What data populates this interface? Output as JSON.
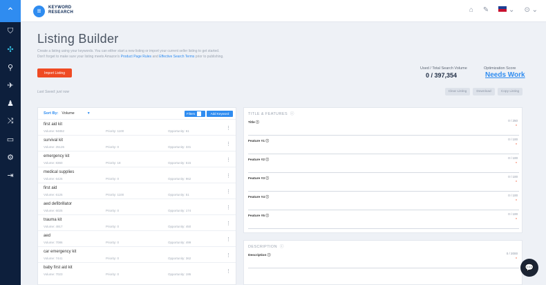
{
  "rail": {
    "items": [
      {
        "icon": "logo-icon",
        "glyph": "⌃"
      },
      {
        "icon": "shield-icon",
        "glyph": "⛉"
      },
      {
        "icon": "nodes-icon",
        "glyph": "✣"
      },
      {
        "icon": "search-icon",
        "glyph": "⚲"
      },
      {
        "icon": "rocket-icon",
        "glyph": "✈"
      },
      {
        "icon": "person-icon",
        "glyph": "♟"
      },
      {
        "icon": "shuffle-icon",
        "glyph": "⤨"
      },
      {
        "icon": "card-icon",
        "glyph": "▭"
      },
      {
        "icon": "settings-icon",
        "glyph": "⚙"
      },
      {
        "icon": "logout-icon",
        "glyph": "⇥"
      }
    ]
  },
  "topbar": {
    "logo_line1": "KEYWORD",
    "logo_line2": "RESEARCH",
    "home_icon": "⌂",
    "pin_icon": "✎",
    "help_icon": "⊙"
  },
  "page": {
    "title": "Listing Builder",
    "desc_line1": "Create a listing using your keywords. You can either start a new listing or import your current seller listing to get started.",
    "desc_line2_pre": "Don't forget to make sure your listing meets Amazon's ",
    "desc_link1": "Product Page Rules",
    "desc_mid": " and ",
    "desc_link2": "Effective Search Terms",
    "desc_post": " prior to publishing.",
    "import_label": "Import Listing",
    "last_saved": "Last Saved: just now",
    "search_volume_label": "Used / Total Search Volume",
    "search_volume_value": "0 / 397,354",
    "optimization_label": "Optimization Score",
    "optimization_value": "Needs Work",
    "clear_label": "Clear Listing",
    "download_label": "Download",
    "copy_label": "Copy Listing"
  },
  "keywords": {
    "sort_label": "Sort By:",
    "sort_value": "Volume",
    "filters_label": "Filters",
    "add_label": "Add Keyword",
    "rows": [
      {
        "name": "first aid kit",
        "volume": "Volume: 94852",
        "priority": "Priority: 1100",
        "opportunity": "Opportunity: 61"
      },
      {
        "name": "survival kit",
        "volume": "Volume: 25126",
        "priority": "Priority: 0",
        "opportunity": "Opportunity: 331"
      },
      {
        "name": "emergency kit",
        "volume": "Volume: 8360",
        "priority": "Priority: 18",
        "opportunity": "Opportunity: 515"
      },
      {
        "name": "medical supplies",
        "volume": "Volume: 6426",
        "priority": "Priority: 0",
        "opportunity": "Opportunity: 962"
      },
      {
        "name": "first aid",
        "volume": "Volume: 6125",
        "priority": "Priority: 1100",
        "opportunity": "Opportunity: 51"
      },
      {
        "name": "aed defibrillator",
        "volume": "Volume: 6025",
        "priority": "Priority: 0",
        "opportunity": "Opportunity: 174"
      },
      {
        "name": "trauma kit",
        "volume": "Volume: 4917",
        "priority": "Priority: 0",
        "opportunity": "Opportunity: 450"
      },
      {
        "name": "aed",
        "volume": "Volume: 7086",
        "priority": "Priority: 0",
        "opportunity": "Opportunity: 499"
      },
      {
        "name": "car emergency kit",
        "volume": "Volume: 7441",
        "priority": "Priority: 0",
        "opportunity": "Opportunity: 362"
      },
      {
        "name": "baby first aid kit",
        "volume": "Volume: 7023",
        "priority": "Priority: 0",
        "opportunity": "Opportunity: 195"
      }
    ]
  },
  "title_features": {
    "heading": "TITLE & FEATURES",
    "fields": [
      {
        "label": "Title",
        "count": "0 / 250"
      },
      {
        "label": "Feature #1",
        "count": "0 / 100"
      },
      {
        "label": "Feature #2",
        "count": "0 / 100"
      },
      {
        "label": "Feature #3",
        "count": "0 / 100"
      },
      {
        "label": "Feature #4",
        "count": "0 / 100"
      },
      {
        "label": "Feature #5",
        "count": "0 / 100"
      }
    ]
  },
  "description": {
    "heading": "DESCRIPTION",
    "field": {
      "label": "Description",
      "count": "0 / 2000"
    }
  },
  "colors": {
    "accent": "#2f8cf0",
    "danger": "#ef4a23",
    "rail": "#0d1f3c"
  }
}
